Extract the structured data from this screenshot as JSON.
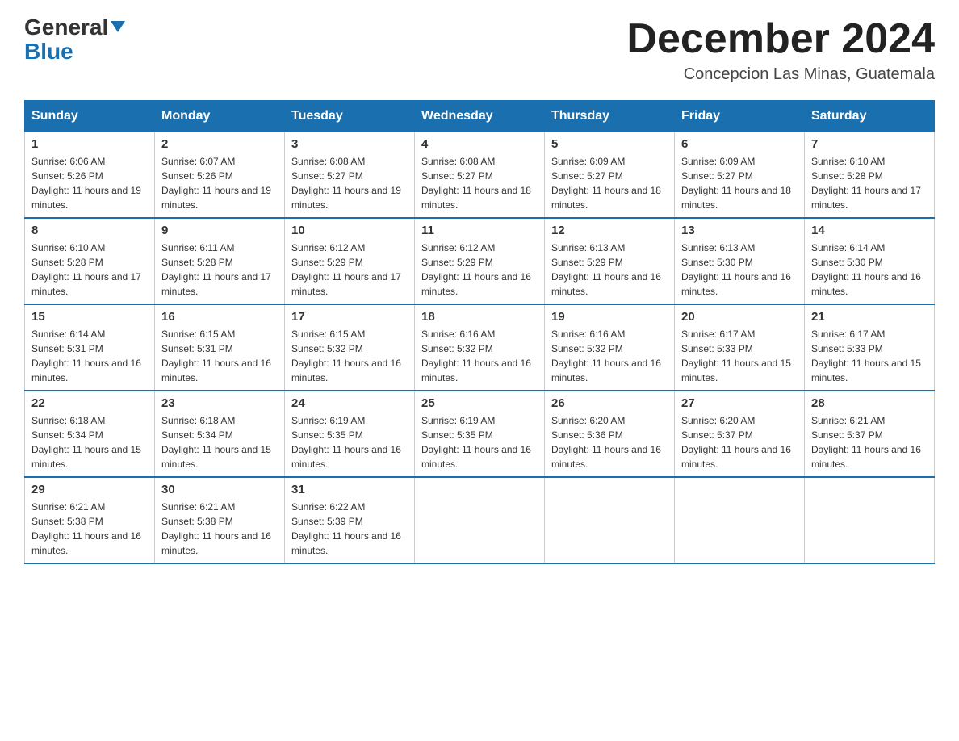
{
  "logo": {
    "general": "General",
    "blue": "Blue"
  },
  "title": "December 2024",
  "subtitle": "Concepcion Las Minas, Guatemala",
  "days_of_week": [
    "Sunday",
    "Monday",
    "Tuesday",
    "Wednesday",
    "Thursday",
    "Friday",
    "Saturday"
  ],
  "weeks": [
    [
      {
        "day": "1",
        "sunrise": "6:06 AM",
        "sunset": "5:26 PM",
        "daylight": "11 hours and 19 minutes."
      },
      {
        "day": "2",
        "sunrise": "6:07 AM",
        "sunset": "5:26 PM",
        "daylight": "11 hours and 19 minutes."
      },
      {
        "day": "3",
        "sunrise": "6:08 AM",
        "sunset": "5:27 PM",
        "daylight": "11 hours and 19 minutes."
      },
      {
        "day": "4",
        "sunrise": "6:08 AM",
        "sunset": "5:27 PM",
        "daylight": "11 hours and 18 minutes."
      },
      {
        "day": "5",
        "sunrise": "6:09 AM",
        "sunset": "5:27 PM",
        "daylight": "11 hours and 18 minutes."
      },
      {
        "day": "6",
        "sunrise": "6:09 AM",
        "sunset": "5:27 PM",
        "daylight": "11 hours and 18 minutes."
      },
      {
        "day": "7",
        "sunrise": "6:10 AM",
        "sunset": "5:28 PM",
        "daylight": "11 hours and 17 minutes."
      }
    ],
    [
      {
        "day": "8",
        "sunrise": "6:10 AM",
        "sunset": "5:28 PM",
        "daylight": "11 hours and 17 minutes."
      },
      {
        "day": "9",
        "sunrise": "6:11 AM",
        "sunset": "5:28 PM",
        "daylight": "11 hours and 17 minutes."
      },
      {
        "day": "10",
        "sunrise": "6:12 AM",
        "sunset": "5:29 PM",
        "daylight": "11 hours and 17 minutes."
      },
      {
        "day": "11",
        "sunrise": "6:12 AM",
        "sunset": "5:29 PM",
        "daylight": "11 hours and 16 minutes."
      },
      {
        "day": "12",
        "sunrise": "6:13 AM",
        "sunset": "5:29 PM",
        "daylight": "11 hours and 16 minutes."
      },
      {
        "day": "13",
        "sunrise": "6:13 AM",
        "sunset": "5:30 PM",
        "daylight": "11 hours and 16 minutes."
      },
      {
        "day": "14",
        "sunrise": "6:14 AM",
        "sunset": "5:30 PM",
        "daylight": "11 hours and 16 minutes."
      }
    ],
    [
      {
        "day": "15",
        "sunrise": "6:14 AM",
        "sunset": "5:31 PM",
        "daylight": "11 hours and 16 minutes."
      },
      {
        "day": "16",
        "sunrise": "6:15 AM",
        "sunset": "5:31 PM",
        "daylight": "11 hours and 16 minutes."
      },
      {
        "day": "17",
        "sunrise": "6:15 AM",
        "sunset": "5:32 PM",
        "daylight": "11 hours and 16 minutes."
      },
      {
        "day": "18",
        "sunrise": "6:16 AM",
        "sunset": "5:32 PM",
        "daylight": "11 hours and 16 minutes."
      },
      {
        "day": "19",
        "sunrise": "6:16 AM",
        "sunset": "5:32 PM",
        "daylight": "11 hours and 16 minutes."
      },
      {
        "day": "20",
        "sunrise": "6:17 AM",
        "sunset": "5:33 PM",
        "daylight": "11 hours and 15 minutes."
      },
      {
        "day": "21",
        "sunrise": "6:17 AM",
        "sunset": "5:33 PM",
        "daylight": "11 hours and 15 minutes."
      }
    ],
    [
      {
        "day": "22",
        "sunrise": "6:18 AM",
        "sunset": "5:34 PM",
        "daylight": "11 hours and 15 minutes."
      },
      {
        "day": "23",
        "sunrise": "6:18 AM",
        "sunset": "5:34 PM",
        "daylight": "11 hours and 15 minutes."
      },
      {
        "day": "24",
        "sunrise": "6:19 AM",
        "sunset": "5:35 PM",
        "daylight": "11 hours and 16 minutes."
      },
      {
        "day": "25",
        "sunrise": "6:19 AM",
        "sunset": "5:35 PM",
        "daylight": "11 hours and 16 minutes."
      },
      {
        "day": "26",
        "sunrise": "6:20 AM",
        "sunset": "5:36 PM",
        "daylight": "11 hours and 16 minutes."
      },
      {
        "day": "27",
        "sunrise": "6:20 AM",
        "sunset": "5:37 PM",
        "daylight": "11 hours and 16 minutes."
      },
      {
        "day": "28",
        "sunrise": "6:21 AM",
        "sunset": "5:37 PM",
        "daylight": "11 hours and 16 minutes."
      }
    ],
    [
      {
        "day": "29",
        "sunrise": "6:21 AM",
        "sunset": "5:38 PM",
        "daylight": "11 hours and 16 minutes."
      },
      {
        "day": "30",
        "sunrise": "6:21 AM",
        "sunset": "5:38 PM",
        "daylight": "11 hours and 16 minutes."
      },
      {
        "day": "31",
        "sunrise": "6:22 AM",
        "sunset": "5:39 PM",
        "daylight": "11 hours and 16 minutes."
      },
      null,
      null,
      null,
      null
    ]
  ]
}
